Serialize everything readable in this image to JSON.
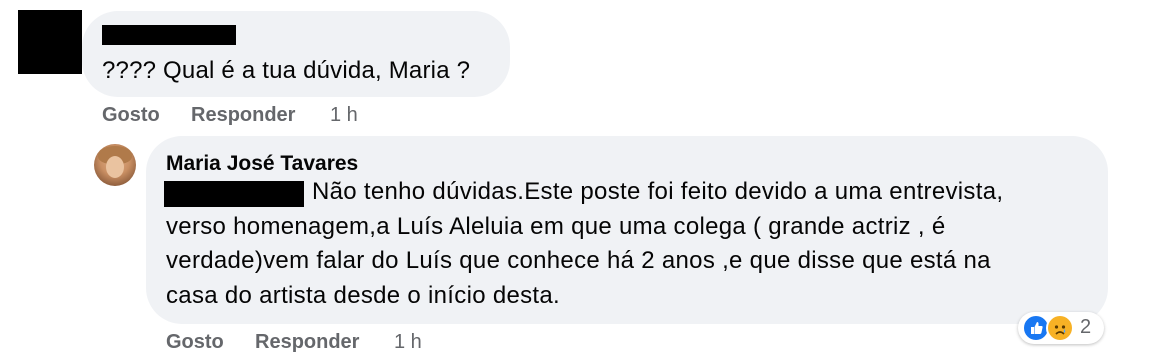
{
  "comment": {
    "text": "???? Qual é a tua dúvida, Maria ?",
    "actions": {
      "like": "Gosto",
      "reply": "Responder",
      "time": "1 h"
    }
  },
  "reply": {
    "author": "Maria José Tavares",
    "lines": [
      "Não tenho dúvidas.Este poste foi feito devido a uma entrevista,",
      "verso homenagem,a Luís Aleluia em que uma colega ( grande actriz , é",
      "verdade)vem falar do Luís que conhece há 2 anos ,e que disse que está na",
      "casa do artista desde o início desta."
    ],
    "actions": {
      "like": "Gosto",
      "reply": "Responder",
      "time": "1 h"
    },
    "reactions": {
      "count": "2",
      "icons": [
        "like-icon",
        "sad-icon"
      ]
    }
  }
}
